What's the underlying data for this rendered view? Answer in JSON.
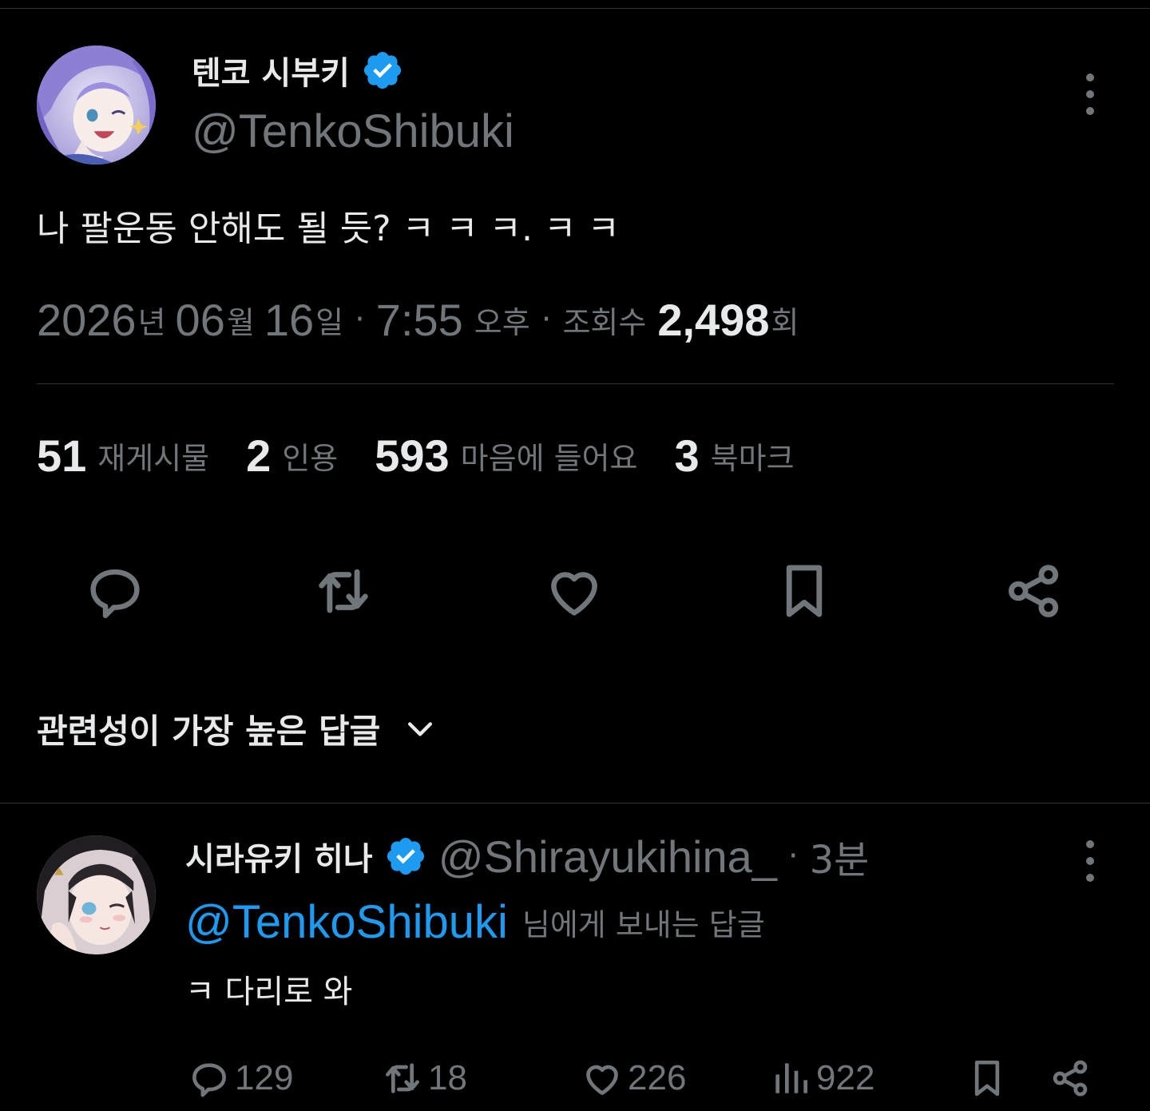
{
  "tweet": {
    "author": {
      "name": "텐코 시부키",
      "handle": "@TenkoShibuki",
      "verified": true
    },
    "text": "나 팔운동 안해도 될 듯? ㅋ ㅋ ㅋ. ㅋ ㅋ",
    "meta": {
      "year": "2026",
      "year_unit": "년",
      "month": "06",
      "month_unit": "월",
      "day": "16",
      "day_unit": "일",
      "separator": "·",
      "time": "7:55",
      "ampm": "오후",
      "views_label": "조회수",
      "views": "2,498",
      "views_unit": "회"
    },
    "stats": [
      {
        "count": "51",
        "label": "재게시물"
      },
      {
        "count": "2",
        "label": "인용"
      },
      {
        "count": "593",
        "label": "마음에 들어요"
      },
      {
        "count": "3",
        "label": "북마크"
      }
    ]
  },
  "sort": {
    "label": "관련성이 가장 높은 답글"
  },
  "reply": {
    "author": {
      "name": "시라유키 히나",
      "handle": "@Shirayukihina_",
      "verified": true
    },
    "separator": "·",
    "time": "3분",
    "reply_to_mention": "@TenkoShibuki",
    "reply_to_suffix": "님에게 보내는 답글",
    "text": "ㅋ 다리로 와",
    "actions": {
      "replies": "129",
      "reposts": "18",
      "likes": "226",
      "views": "922"
    }
  },
  "colors": {
    "background": "#000000",
    "text_primary": "#e7e9ea",
    "text_secondary": "#71767b",
    "accent": "#1d9bf0",
    "divider": "#2f3336"
  }
}
